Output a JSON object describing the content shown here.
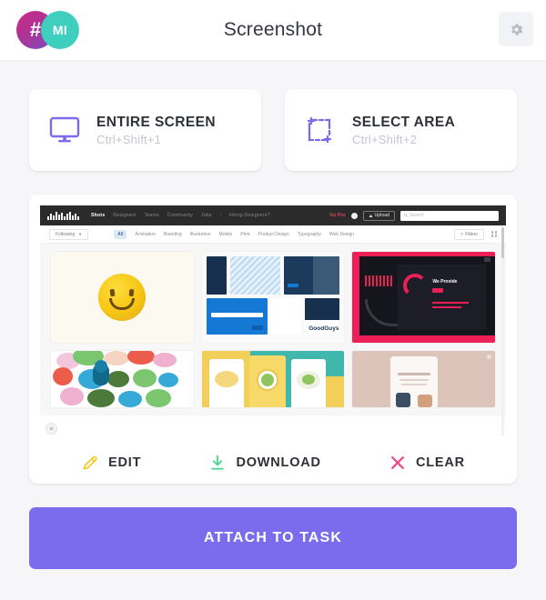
{
  "header": {
    "title": "Screenshot",
    "logo": {
      "mark": "#",
      "badge": "MI"
    },
    "settings_icon": "gear-icon"
  },
  "capture_modes": [
    {
      "title": "ENTIRE SCREEN",
      "shortcut": "Ctrl+Shift+1",
      "icon": "monitor-icon",
      "accent": "#7b6ced"
    },
    {
      "title": "SELECT AREA",
      "shortcut": "Ctrl+Shift+2",
      "icon": "crop-selection-icon",
      "accent": "#7b6ced"
    }
  ],
  "preview": {
    "close_icon": "close-icon",
    "screenshot_site": {
      "nav": {
        "logo": "dribbble-logo",
        "links": [
          "Shots",
          "Designers",
          "Teams",
          "Community",
          "Jobs"
        ],
        "active_link": "Shots",
        "separator": "|",
        "hiring": "Hiring Designers?",
        "go_pro": "Go Pro",
        "upload": "Upload",
        "search_placeholder": "Search"
      },
      "filters": {
        "following": "Following",
        "categories": [
          "All",
          "Animation",
          "Branding",
          "Illustration",
          "Mobile",
          "Print",
          "Product Design",
          "Typography",
          "Web Design"
        ],
        "active_category": "All",
        "filters_label": "Filters",
        "grid_icon": "grid-view-icon"
      },
      "thumbnails": [
        {
          "name": "smiley-illustration"
        },
        {
          "name": "goodguys-branding-deck",
          "brand": "GoodGuys"
        },
        {
          "name": "dark-pink-web-design",
          "heading": "We Provide"
        },
        {
          "name": "colorful-abstract-illustration"
        },
        {
          "name": "food-app-mobile-screens"
        },
        {
          "name": "beige-mobile-mockup"
        }
      ]
    },
    "actions": [
      {
        "label": "EDIT",
        "icon": "pencil-icon",
        "color": "#f5c518"
      },
      {
        "label": "DOWNLOAD",
        "icon": "download-icon",
        "color": "#4ad991"
      },
      {
        "label": "CLEAR",
        "icon": "x-icon",
        "color": "#f3457f"
      }
    ]
  },
  "attach": {
    "label": "ATTACH TO TASK",
    "color": "#7b6ced"
  }
}
